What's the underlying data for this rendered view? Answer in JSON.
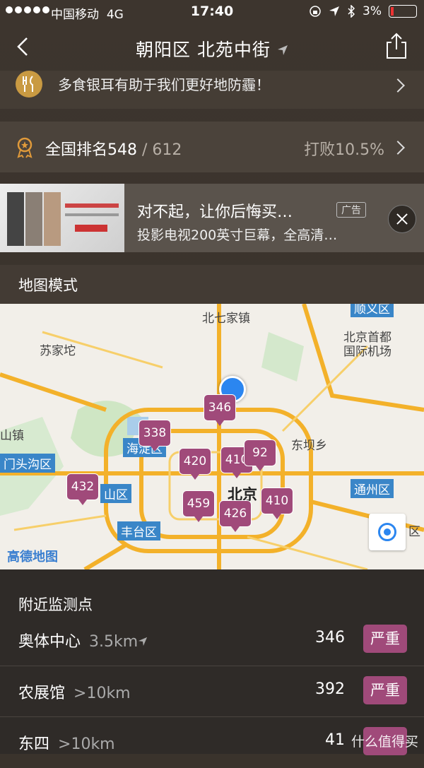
{
  "status": {
    "carrier": "中国移动",
    "network": "4G",
    "time": "17:40",
    "battery": "3%"
  },
  "nav": {
    "title": "朝阳区 北苑中街"
  },
  "tip": {
    "text": "多食银耳有助于我们更好地防霾！"
  },
  "rank": {
    "label": "全国排名548",
    "total": " / 612",
    "beat": "打败10.5%"
  },
  "ad": {
    "title": "对不起，让你后悔买…",
    "tag": "广告",
    "subtitle": "投影电视200英寸巨幕，全高清…"
  },
  "map_section": {
    "title": "地图模式"
  },
  "map": {
    "labels": [
      "北七家镇",
      "苏家坨",
      "北京首都\n国际机场",
      "东坝乡",
      "山镇",
      "北京"
    ],
    "districts": [
      "顺义区",
      "海淀区",
      "门头沟区",
      "山区",
      "通州区",
      "丰台区",
      "区"
    ],
    "markers": [
      "346",
      "338",
      "420",
      "410",
      "92",
      "432",
      "459",
      "426",
      "410"
    ],
    "brand": "高德地图"
  },
  "nearby": {
    "title": "附近监测点",
    "items": [
      {
        "name": "奥体中心",
        "distance": "3.5km",
        "value": "346",
        "level": "严重"
      },
      {
        "name": "农展馆",
        "distance": ">10km",
        "value": "392",
        "level": "严重"
      },
      {
        "name": "东四",
        "distance": ">10km",
        "value": "41",
        "level": ""
      }
    ],
    "watermark": "什么值得买"
  },
  "colors": {
    "severe": "#a04a7a",
    "accent": "#2b86f0"
  }
}
